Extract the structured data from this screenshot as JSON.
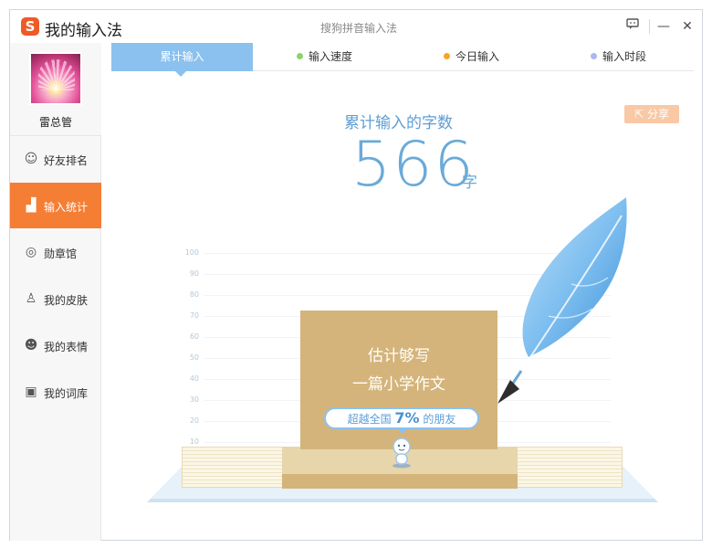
{
  "titlebar": {
    "logo_glyph": "S",
    "app_title": "我的输入法",
    "center_title": "搜狗拼音输入法",
    "feedback_glyph": "☐",
    "minimize_glyph": "—",
    "close_glyph": "✕"
  },
  "sidebar": {
    "username": "雷总管",
    "items": [
      {
        "label": "好友排名",
        "icon": "friends-icon",
        "glyph": "☺"
      },
      {
        "label": "输入统计",
        "icon": "stats-chart-icon",
        "glyph": "▟"
      },
      {
        "label": "勋章馆",
        "icon": "medal-icon",
        "glyph": "◎"
      },
      {
        "label": "我的皮肤",
        "icon": "tshirt-icon",
        "glyph": "♙"
      },
      {
        "label": "我的表情",
        "icon": "smiley-icon",
        "glyph": "☻"
      },
      {
        "label": "我的词库",
        "icon": "dictionary-icon",
        "glyph": "▣"
      }
    ]
  },
  "tabs": [
    {
      "label": "累计输入",
      "active": true
    },
    {
      "label": "输入速度",
      "dot_color": "#8ed26a"
    },
    {
      "label": "今日输入",
      "dot_color": "#f6a623"
    },
    {
      "label": "输入时段",
      "dot_color": "#a9b8f0"
    }
  ],
  "main": {
    "title": "累计输入的字数",
    "share_label": "分享",
    "count": "566",
    "unit": "字",
    "card_line1": "估计够写",
    "card_line2": "一篇小学作文",
    "pill_prefix": "超越全国",
    "pill_percent": "7%",
    "pill_suffix": "的朋友"
  },
  "chart_data": {
    "type": "bar",
    "y_ticks": [
      "100",
      "90",
      "80",
      "70",
      "60",
      "50",
      "40",
      "30",
      "20",
      "10"
    ],
    "ylim": [
      0,
      100
    ],
    "values": [
      7
    ],
    "colors": {
      "accent": "#f57e35",
      "tab_active": "#8bc1ef",
      "card": "#d4b47a"
    }
  }
}
